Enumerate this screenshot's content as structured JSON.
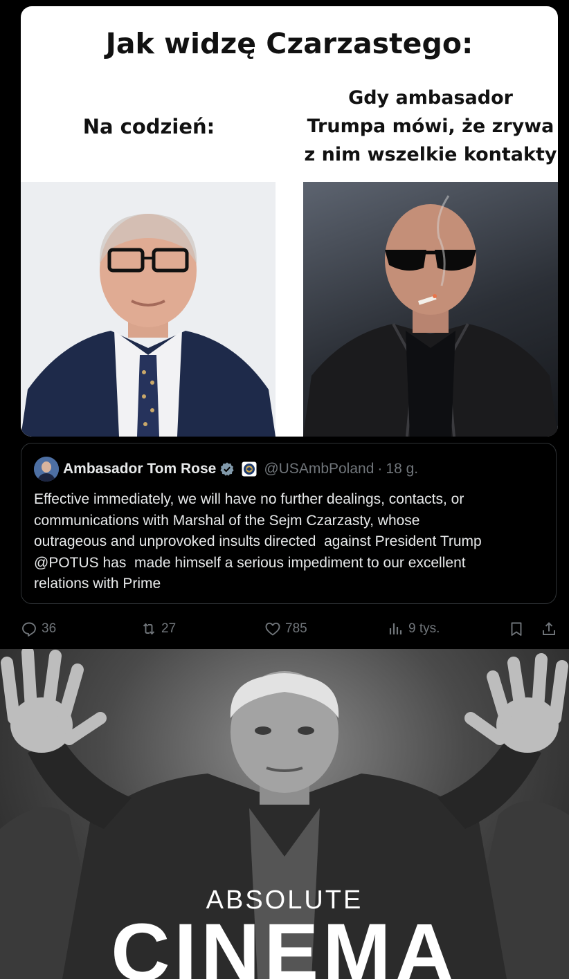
{
  "meme": {
    "title": "Jak widzę Czarzastego:",
    "caption_left": "Na codzień:",
    "caption_right": "Gdy ambasador\nTrumpa mówi, że zrywa\nz nim wszelkie kontakty"
  },
  "quoted_post": {
    "author_name": "Ambasador Tom Rose",
    "handle": "@USAmbPoland",
    "separator": "·",
    "time": "18 g.",
    "text": "Effective immediately, we will have no further dealings, contacts, or\ncommunications with Marshal of the Sejm Czarzasty, whose\noutrageous and unprovoked insults directed  against President Trump\n@POTUS has  made himself a serious impediment to our excellent\nrelations with Prime"
  },
  "actions": {
    "replies": "36",
    "reposts": "27",
    "likes": "785",
    "views": "9 tys."
  },
  "bottom_meme": {
    "line1": "ABSOLUTE",
    "line2": "CINEMA"
  },
  "icons": [
    "verified-badge-icon",
    "embassy-seal-icon",
    "reply-icon",
    "repost-icon",
    "like-icon",
    "views-icon",
    "bookmark-icon",
    "share-icon"
  ],
  "colors": {
    "background": "#000000",
    "text": "#e7e9ea",
    "muted": "#71767b",
    "border": "#2f3336",
    "verified": "#829aab"
  }
}
